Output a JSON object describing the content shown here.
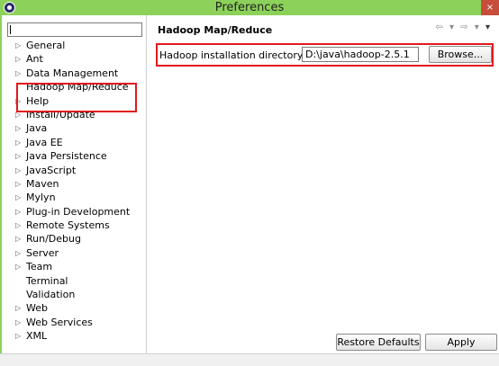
{
  "window": {
    "title": "Preferences",
    "close_label": "×"
  },
  "filter": {
    "value": ""
  },
  "tree": {
    "items": [
      {
        "label": "General",
        "expandable": true
      },
      {
        "label": "Ant",
        "expandable": true
      },
      {
        "label": "Data Management",
        "expandable": true
      },
      {
        "label": "Hadoop Map/Reduce",
        "expandable": false
      },
      {
        "label": "Help",
        "expandable": true
      },
      {
        "label": "Install/Update",
        "expandable": true
      },
      {
        "label": "Java",
        "expandable": true
      },
      {
        "label": "Java EE",
        "expandable": true
      },
      {
        "label": "Java Persistence",
        "expandable": true
      },
      {
        "label": "JavaScript",
        "expandable": true
      },
      {
        "label": "Maven",
        "expandable": true
      },
      {
        "label": "Mylyn",
        "expandable": true
      },
      {
        "label": "Plug-in Development",
        "expandable": true
      },
      {
        "label": "Remote Systems",
        "expandable": true
      },
      {
        "label": "Run/Debug",
        "expandable": true
      },
      {
        "label": "Server",
        "expandable": true
      },
      {
        "label": "Team",
        "expandable": true
      },
      {
        "label": "Terminal",
        "expandable": false
      },
      {
        "label": "Validation",
        "expandable": false
      },
      {
        "label": "Web",
        "expandable": true
      },
      {
        "label": "Web Services",
        "expandable": true
      },
      {
        "label": "XML",
        "expandable": true
      }
    ]
  },
  "page": {
    "title": "Hadoop Map/Reduce",
    "nav": {
      "back": "⇦",
      "forward": "⇨",
      "dropdown": "▾",
      "menu": "▾"
    },
    "install_dir_label": "Hadoop installation directory:",
    "install_dir_value": "D:\\java\\hadoop-2.5.1",
    "browse_label": "Browse...",
    "restore_defaults_label": "Restore Defaults",
    "apply_label": "Apply"
  }
}
